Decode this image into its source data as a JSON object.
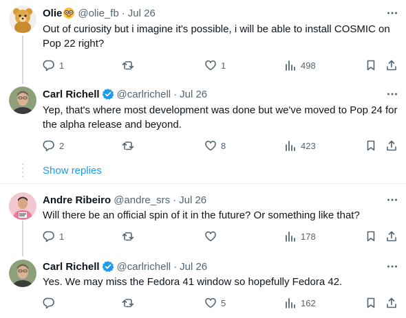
{
  "tweets": [
    {
      "name": "Olie",
      "handle": "@olie_fb",
      "dot": "·",
      "time": "Jul 26",
      "text": "Out of curiosity but i imagine it's possible, i will be able to install COSMIC on Pop 22 right?",
      "replies": "1",
      "retweets": "",
      "likes": "1",
      "views": "498",
      "name_emoji": "nerd-face-emoji",
      "avatar": "teddy-bear-avatar",
      "verified": false
    },
    {
      "name": "Carl Richell",
      "handle": "@carlrichell",
      "dot": "·",
      "time": "Jul 26",
      "text": "Yep, that's where most development was done but we've moved to Pop 24 for the alpha release and beyond.",
      "replies": "2",
      "retweets": "",
      "likes": "8",
      "views": "423",
      "avatar": "man-portrait-avatar",
      "verified": true
    },
    {
      "name": "Andre Ribeiro",
      "handle": "@andre_srs",
      "dot": "·",
      "time": "Jul 26",
      "text": "Will there be an official spin of it in the future? Or something like that?",
      "replies": "1",
      "retweets": "",
      "likes": "",
      "views": "178",
      "avatar": "man-pink-shirt-avatar",
      "verified": false
    },
    {
      "name": "Carl Richell",
      "handle": "@carlrichell",
      "dot": "·",
      "time": "Jul 26",
      "text": "Yes. We may miss the Fedora 41 window so hopefully Fedora 42.",
      "replies": "",
      "retweets": "",
      "likes": "5",
      "views": "162",
      "avatar": "man-portrait-avatar",
      "verified": true
    }
  ],
  "show_replies": "Show replies",
  "colors": {
    "text": "#0f1419",
    "secondary": "#536471",
    "link": "#1d9bf0",
    "verified": "#1d9bf0",
    "line": "#cfd9de"
  },
  "icons": [
    "reply-icon",
    "retweet-icon",
    "like-icon",
    "views-icon",
    "bookmark-icon",
    "share-icon",
    "more-icon",
    "verified-badge-icon"
  ]
}
